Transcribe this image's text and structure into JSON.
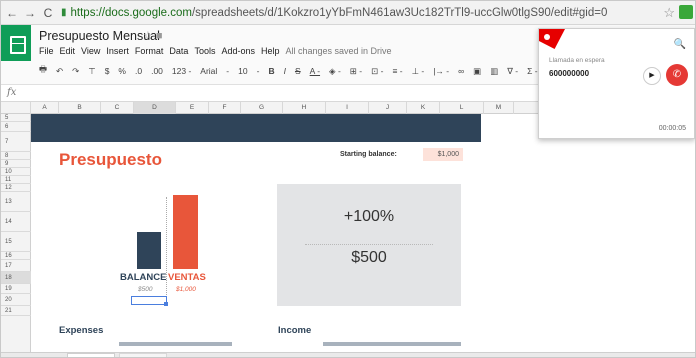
{
  "browser": {
    "url_host": "https://docs.google.com",
    "url_path": "/spreadsheets/d/1Kokzro1yYbFmN461aw3Uc182TrTl9-uccGlw0tlgS90/edit#gid=0",
    "back_glyph": "←",
    "forward_glyph": "→",
    "reload_glyph": "C",
    "lock_glyph": "🔒",
    "star_glyph": "☆"
  },
  "doc": {
    "title": "Presupuesto Mensual",
    "title_icons": "☆ ■",
    "menu": [
      "File",
      "Edit",
      "View",
      "Insert",
      "Format",
      "Data",
      "Tools",
      "Add-ons",
      "Help"
    ],
    "save_status": "All changes saved in Drive",
    "toolbar": [
      "🖶",
      "↶",
      "↷",
      "⊤",
      "$",
      "%",
      ".0",
      ".00",
      "123 -",
      "Arial",
      "-",
      "10",
      "-",
      "B",
      "I",
      "S",
      "A -",
      "◈ -",
      "⊞ -",
      "⊡ -",
      "≡ -",
      "⊥ -",
      "|→ -",
      "∞",
      "▣",
      "▥",
      "∇ -",
      "Σ -"
    ]
  },
  "formula_bar": {
    "label": "fx"
  },
  "grid": {
    "columns": [
      "A",
      "B",
      "C",
      "D",
      "E",
      "F",
      "G",
      "H",
      "I",
      "J",
      "K",
      "L",
      "M"
    ],
    "selected_column": "D",
    "rows": [
      "5",
      "6",
      "7",
      "8",
      "9",
      "10",
      "11",
      "12",
      "13",
      "14",
      "15",
      "16",
      "17",
      "18",
      "19",
      "20",
      "21"
    ],
    "selected_row": "18"
  },
  "budget": {
    "title": "Presupuesto",
    "starting_balance_label": "Starting balance:",
    "starting_balance_value": "$1,000",
    "bar_chart": {
      "categories": [
        "BALANCE",
        "VENTAS"
      ],
      "values": [
        "$500",
        "$1,000"
      ],
      "colors": {
        "BALANCE": "#2f4459",
        "VENTAS": "#e8563a"
      }
    },
    "percent_change": "+100%",
    "amount": "$500",
    "expenses_heading": "Expenses",
    "income_heading": "Income"
  },
  "call_popup": {
    "search_glyph": "🔍",
    "status": "Llamada en espera",
    "number": "600000000",
    "play_glyph": "▶",
    "hangup_glyph": "✆",
    "timer": "00:00:05"
  }
}
